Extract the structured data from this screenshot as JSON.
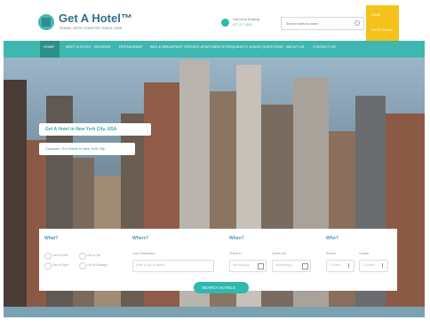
{
  "header": {
    "logo_title": "Get A Hotel™",
    "logo_tagline": "TRAVEL WITH COMFORT SINCE 1996",
    "phone_label": "Call Us for Booking",
    "phone_number": "877-377-8830",
    "search_placeholder": "Search hotels by name"
  },
  "ribbon": {
    "items": [
      "HOME",
      "HOTEL DEALS",
      "SIGN IN"
    ]
  },
  "nav": {
    "items": [
      "HOME",
      "MEET A HOTEL",
      "REVIEWS",
      "RESTAURANT",
      "BED & BREAKFAST",
      "SERVICE APARTMENTS",
      "FREQUENTLY ASKED QUESTIONS",
      "ABOUT US",
      "CONTACT US"
    ]
  },
  "hero": {
    "headline": "Get A Hotel in New York City, USA",
    "subline": "Compare 714 Hotels in New York City"
  },
  "search_panel": {
    "what_heading": "What?",
    "what_options": [
      "Get a Hotel",
      "Get a Car",
      "Get a Flight",
      "Get a Package"
    ],
    "where_heading": "Where?",
    "destination_label": "Your Destination",
    "destination_placeholder": "Enter a city or airport",
    "when_heading": "When?",
    "checkin_label": "Check in",
    "checkin_placeholder": "dd/mm/yyyy",
    "checkout_label": "Check out",
    "checkout_placeholder": "dd/mm/yyyy",
    "who_heading": "Who?",
    "rooms_label": "Rooms",
    "rooms_value": "1 Room",
    "guests_label": "Guests",
    "guests_value": "2 Guests",
    "submit_label": "SEARCH HOTELS"
  },
  "colors": {
    "accent": "#3fb7b0",
    "brand": "#2e6f89",
    "ribbon": "#f4c21b"
  }
}
